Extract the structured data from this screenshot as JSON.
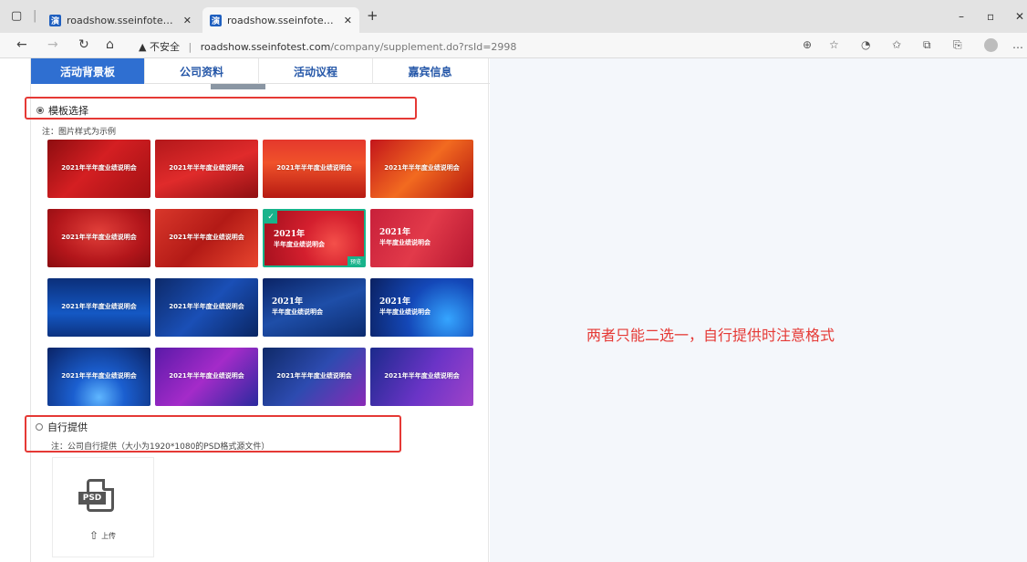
{
  "browser": {
    "tabs": [
      {
        "favicon": "演",
        "title": "roadshow.sseinfotest.com/comp",
        "close": "✕"
      },
      {
        "favicon": "演",
        "title": "roadshow.sseinfotest.com/comp",
        "close": "✕"
      }
    ],
    "new_tab": "+",
    "security_label": "不安全",
    "url_host": "roadshow.sseinfotest.com",
    "url_path": "/company/supplement.do?rsId=2998"
  },
  "page_tabs": [
    {
      "label": "活动背景板"
    },
    {
      "label": "公司资料"
    },
    {
      "label": "活动议程"
    },
    {
      "label": "嘉宾信息"
    }
  ],
  "template_section": {
    "label": "模板选择",
    "note": "注：图片样式为示例",
    "selected_index": 6,
    "preview_label": "预览"
  },
  "thumbnails": [
    {
      "title": "2021年半年度业绩说明会",
      "style": "red1"
    },
    {
      "title": "2021年半年度业绩说明会",
      "style": "red2"
    },
    {
      "title": "2021年半年度业绩说明会",
      "style": "red3"
    },
    {
      "title": "2021年半年度业绩说明会",
      "style": "red4"
    },
    {
      "title": "2021年半年度业绩说明会",
      "style": "red5"
    },
    {
      "title": "2021年半年度业绩说明会",
      "style": "red6"
    },
    {
      "title": "2021年",
      "title2": "半年度业绩说明会",
      "style": "red7"
    },
    {
      "title": "2021年",
      "title2": "半年度业绩说明会",
      "style": "red8"
    },
    {
      "title": "2021年半年度业绩说明会",
      "style": "blue1"
    },
    {
      "title": "2021年半年度业绩说明会",
      "style": "blue2"
    },
    {
      "title": "2021年",
      "title2": "半年度业绩说明会",
      "style": "blue3"
    },
    {
      "title": "2021年",
      "title2": "半年度业绩说明会",
      "style": "blue4"
    },
    {
      "title": "2021年半年度业绩说明会",
      "style": "blue5"
    },
    {
      "title": "2021年半年度业绩说明会",
      "style": "purple1"
    },
    {
      "title": "2021年半年度业绩说明会",
      "style": "blue6"
    },
    {
      "title": "2021年半年度业绩说明会",
      "style": "purple2"
    }
  ],
  "self_section": {
    "label": "自行提供",
    "note": "注：公司自行提供（大小为1920*1080的PSD格式源文件）"
  },
  "upload": {
    "file_type": "PSD",
    "label": "上传"
  },
  "annotation": "两者只能二选一，自行提供时注意格式",
  "colors": {
    "active_tab": "#2f6fd1",
    "tab_text": "#2557a8",
    "annotation_red": "#e53935",
    "selected_green": "#18b38b"
  }
}
